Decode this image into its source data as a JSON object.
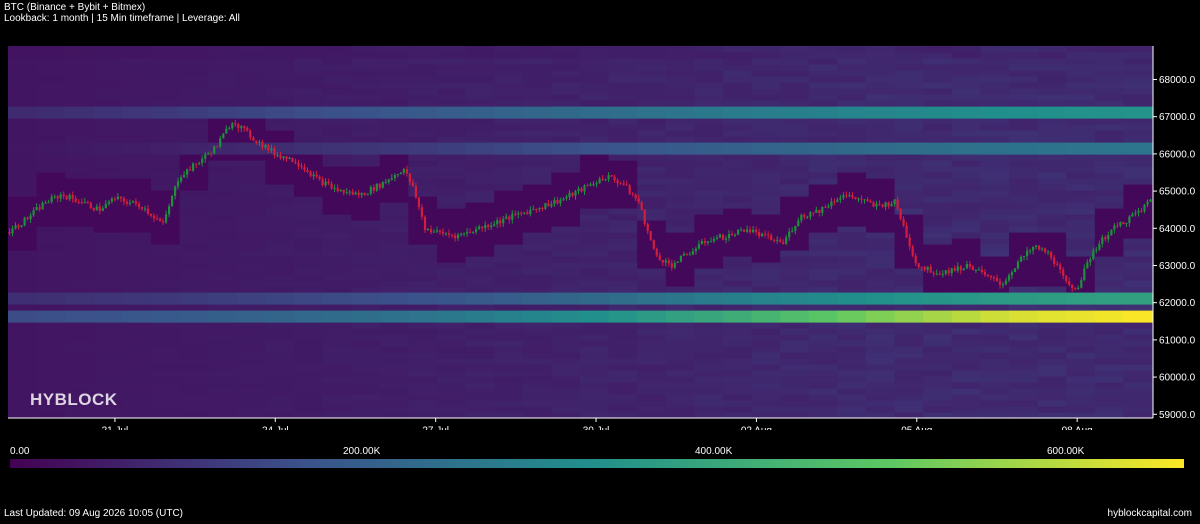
{
  "header": {
    "title": "BTC (Binance + Bybit + Bitmex)",
    "subtitle": "Lookback: 1 month | 15 Min timeframe | Leverage: All"
  },
  "watermark": "HYBLOCK",
  "footer": {
    "last_updated": "Last Updated: 09 Aug 2026 10:05 (UTC)",
    "site": "hyblockcapital.com"
  },
  "colors": {
    "scale": [
      "#440154",
      "#3b528b",
      "#21908c",
      "#5dc863",
      "#fde725"
    ],
    "candle_up": "#1e8f3a",
    "candle_down": "#d21e3c",
    "background": "#000000"
  },
  "chart_data": {
    "type": "heatmap",
    "title": "BTC (Binance + Bybit + Bitmex)",
    "ylim": [
      58900,
      68900
    ],
    "y_ticks": [
      "59000.0",
      "60000.0",
      "61000.0",
      "62000.0",
      "63000.0",
      "64000.0",
      "65000.0",
      "66000.0",
      "67000.0",
      "68000.0"
    ],
    "x_ticks": [
      {
        "label": "21 Jul",
        "day": 2
      },
      {
        "label": "24 Jul",
        "day": 5
      },
      {
        "label": "27 Jul",
        "day": 8
      },
      {
        "label": "30 Jul",
        "day": 11
      },
      {
        "label": "02 Aug",
        "day": 14
      },
      {
        "label": "05 Aug",
        "day": 17
      },
      {
        "label": "08 Aug",
        "day": 20
      }
    ],
    "x_range_days": [
      0,
      21.4
    ],
    "price_path": [
      [
        0.0,
        63900
      ],
      [
        0.3,
        64200
      ],
      [
        0.7,
        64700
      ],
      [
        1.0,
        64900
      ],
      [
        1.4,
        64700
      ],
      [
        1.7,
        64500
      ],
      [
        2.0,
        64800
      ],
      [
        2.5,
        64600
      ],
      [
        2.9,
        64100
      ],
      [
        3.2,
        65400
      ],
      [
        3.5,
        65700
      ],
      [
        3.9,
        66200
      ],
      [
        4.2,
        66900
      ],
      [
        4.6,
        66400
      ],
      [
        5.0,
        66000
      ],
      [
        5.4,
        65800
      ],
      [
        5.8,
        65300
      ],
      [
        6.2,
        65000
      ],
      [
        6.6,
        64900
      ],
      [
        7.0,
        65200
      ],
      [
        7.4,
        65600
      ],
      [
        7.6,
        65000
      ],
      [
        7.8,
        64000
      ],
      [
        8.0,
        63900
      ],
      [
        8.4,
        63800
      ],
      [
        8.8,
        64000
      ],
      [
        9.2,
        64200
      ],
      [
        9.6,
        64400
      ],
      [
        10.0,
        64600
      ],
      [
        10.4,
        64800
      ],
      [
        10.8,
        65100
      ],
      [
        11.2,
        65400
      ],
      [
        11.5,
        65200
      ],
      [
        11.8,
        64700
      ],
      [
        12.1,
        63300
      ],
      [
        12.4,
        63000
      ],
      [
        12.8,
        63400
      ],
      [
        13.1,
        63700
      ],
      [
        13.5,
        63800
      ],
      [
        13.8,
        64000
      ],
      [
        14.1,
        63800
      ],
      [
        14.5,
        63600
      ],
      [
        14.8,
        64300
      ],
      [
        15.2,
        64500
      ],
      [
        15.6,
        64900
      ],
      [
        15.9,
        64800
      ],
      [
        16.2,
        64600
      ],
      [
        16.6,
        64700
      ],
      [
        17.0,
        63000
      ],
      [
        17.4,
        62800
      ],
      [
        17.7,
        62900
      ],
      [
        18.0,
        63000
      ],
      [
        18.3,
        62700
      ],
      [
        18.6,
        62500
      ],
      [
        18.9,
        63100
      ],
      [
        19.2,
        63500
      ],
      [
        19.5,
        63300
      ],
      [
        19.8,
        62500
      ],
      [
        20.0,
        62400
      ],
      [
        20.3,
        63400
      ],
      [
        20.6,
        63900
      ],
      [
        20.9,
        64200
      ],
      [
        21.2,
        64500
      ],
      [
        21.4,
        64800
      ]
    ],
    "liquidation_bands": [
      {
        "price": 61700,
        "values": [
          150000,
          180000,
          220000,
          260000,
          320000,
          400000,
          520000,
          620000,
          660000
        ]
      },
      {
        "price": 62100,
        "values": [
          90000,
          110000,
          140000,
          170000,
          220000,
          280000,
          330000,
          360000,
          380000
        ]
      },
      {
        "price": 67100,
        "values": [
          80000,
          110000,
          150000,
          190000,
          230000,
          270000,
          300000,
          330000,
          340000
        ]
      },
      {
        "price": 66100,
        "values": [
          40000,
          60000,
          90000,
          120000,
          160000,
          200000,
          230000,
          250000,
          260000
        ]
      }
    ],
    "colorbar": {
      "min": 0,
      "max": 660000,
      "tick_labels": [
        {
          "label": "0.00",
          "value": 0
        },
        {
          "label": "200.00K",
          "value": 200000
        },
        {
          "label": "400.00K",
          "value": 400000
        },
        {
          "label": "600.00K",
          "value": 600000
        }
      ]
    },
    "grid": false,
    "legend": "colorbar-bottom"
  }
}
